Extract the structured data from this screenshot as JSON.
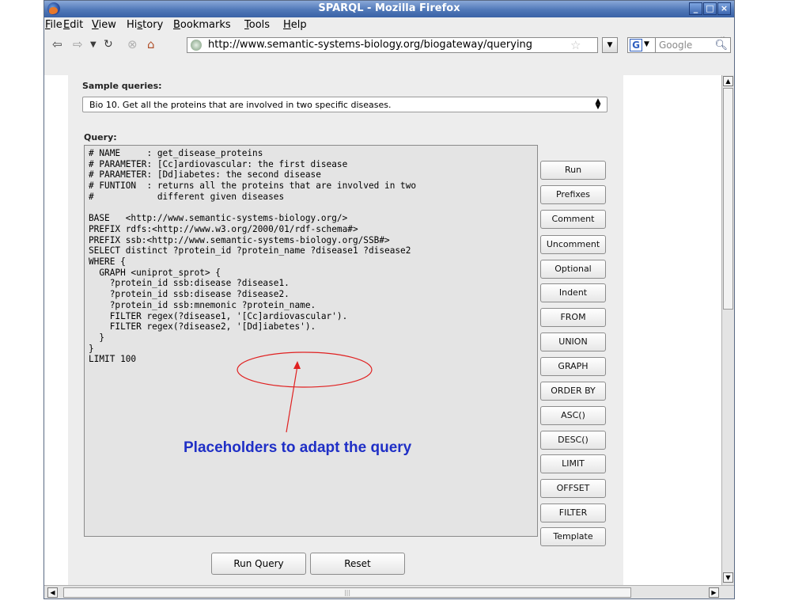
{
  "window": {
    "title": "SPARQL - Mozilla Firefox",
    "buttons": {
      "minimize": "_",
      "maximize": "□",
      "close": "×"
    }
  },
  "menubar": {
    "items": [
      {
        "label": "File",
        "mnemonic": "F",
        "rest": "ile"
      },
      {
        "label": "Edit",
        "mnemonic": "E",
        "rest": "dit"
      },
      {
        "label": "View",
        "mnemonic": "V",
        "rest": "iew"
      },
      {
        "label": "History",
        "pre": "Hi",
        "mnemonic": "s",
        "rest": "tory"
      },
      {
        "label": "Bookmarks",
        "mnemonic": "B",
        "rest": "ookmarks"
      },
      {
        "label": "Tools",
        "mnemonic": "T",
        "rest": "ools"
      },
      {
        "label": "Help",
        "mnemonic": "H",
        "rest": "elp"
      }
    ]
  },
  "navbar": {
    "url": "http://www.semantic-systems-biology.org/biogateway/querying",
    "search_placeholder": "Google",
    "search_engine_letter": "G"
  },
  "page": {
    "sample_label": "Sample queries:",
    "sample_selected": "Bio 10. Get all the proteins that are involved in two specific diseases.",
    "query_label": "Query:",
    "query_text": "# NAME     : get_disease_proteins\n# PARAMETER: [Cc]ardiovascular: the first disease\n# PARAMETER: [Dd]iabetes: the second disease\n# FUNTION  : returns all the proteins that are involved in two\n#            different given diseases\n\nBASE   <http://www.semantic-systems-biology.org/>\nPREFIX rdfs:<http://www.w3.org/2000/01/rdf-schema#>\nPREFIX ssb:<http://www.semantic-systems-biology.org/SSB#>\nSELECT distinct ?protein_id ?protein_name ?disease1 ?disease2\nWHERE {\n  GRAPH <uniprot_sprot> {\n    ?protein_id ssb:disease ?disease1.\n    ?protein_id ssb:disease ?disease2.\n    ?protein_id ssb:mnemonic ?protein_name.\n    FILTER regex(?disease1, '[Cc]ardiovascular').\n    FILTER regex(?disease2, '[Dd]iabetes').\n  }\n}\nLIMIT 100",
    "side_buttons": [
      "Run",
      "Prefixes",
      "Comment",
      "Uncomment",
      "Optional",
      "Indent",
      "FROM",
      "UNION",
      "GRAPH",
      "ORDER BY",
      "ASC()",
      "DESC()",
      "LIMIT",
      "OFFSET",
      "FILTER",
      "Template"
    ],
    "run_query": "Run Query",
    "reset": "Reset"
  },
  "annotation": {
    "text": "Placeholders to adapt the query",
    "color": "#1f2fc6",
    "ellipse_color": "#e02020"
  },
  "icons": {
    "back": "back-arrow-icon",
    "forward": "forward-arrow-icon",
    "reload": "reload-icon",
    "stop": "stop-icon",
    "home": "home-icon",
    "bookmark_star": "star-icon",
    "search": "magnifier-icon"
  }
}
